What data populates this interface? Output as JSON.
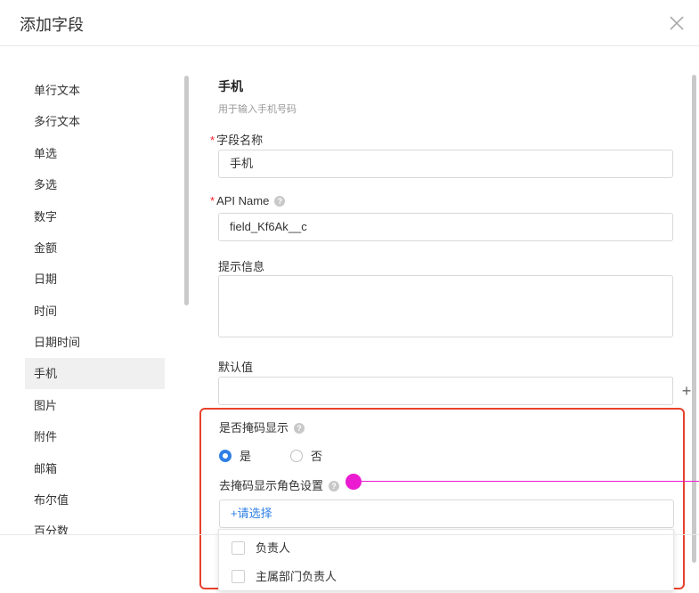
{
  "dialog": {
    "title": "添加字段",
    "close_icon": "close-icon"
  },
  "sidebar": {
    "items": [
      {
        "label": "单行文本"
      },
      {
        "label": "多行文本"
      },
      {
        "label": "单选"
      },
      {
        "label": "多选"
      },
      {
        "label": "数字"
      },
      {
        "label": "金额"
      },
      {
        "label": "日期"
      },
      {
        "label": "时间"
      },
      {
        "label": "日期时间"
      },
      {
        "label": "手机"
      },
      {
        "label": "图片"
      },
      {
        "label": "附件"
      },
      {
        "label": "邮箱"
      },
      {
        "label": "布尔值"
      },
      {
        "label": "百分数"
      }
    ],
    "active": "手机"
  },
  "form": {
    "field_type_title": "手机",
    "field_type_desc": "用于输入手机号码",
    "name": {
      "label": "字段名称",
      "required_mark": "*",
      "value": "手机"
    },
    "api": {
      "label": "API Name",
      "required_mark": "*",
      "help_icon": "?",
      "value": "field_Kf6Ak__c"
    },
    "hint": {
      "label": "提示信息",
      "value": ""
    },
    "default": {
      "label": "默认值",
      "value": "",
      "add_button": "+"
    },
    "masked": {
      "label": "是否掩码显示",
      "help_icon": "?",
      "options": [
        {
          "label": "是",
          "selected": true
        },
        {
          "label": "否",
          "selected": false
        }
      ]
    },
    "unmask_roles": {
      "label": "去掩码显示角色设置",
      "help_icon": "?",
      "placeholder": "+请选择",
      "dropdown": [
        {
          "label": "负责人",
          "checked": false
        },
        {
          "label": "主属部门负责人",
          "checked": false
        }
      ]
    }
  },
  "colors": {
    "accent": "#2f7fe6",
    "required": "#f5222d",
    "highlight_border": "#e8412c",
    "pointer": "#ea1bd0"
  }
}
